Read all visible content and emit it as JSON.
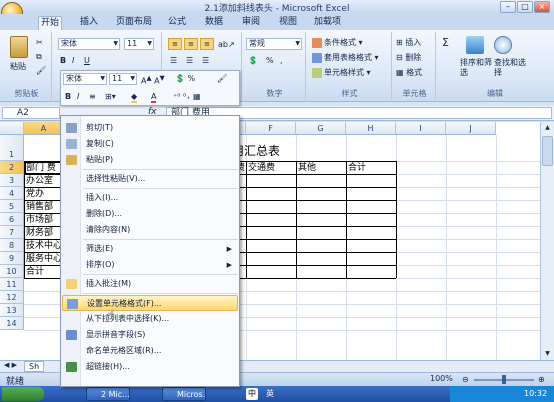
{
  "window": {
    "title": "2.1添加斜线表头 - Microsoft Excel"
  },
  "tabs": [
    "开始",
    "插入",
    "页面布局",
    "公式",
    "数据",
    "审阅",
    "视图",
    "加载项"
  ],
  "ribbon": {
    "paste": "粘贴",
    "clipboard_label": "剪贴板",
    "font_name": "宋体",
    "font_size": "11",
    "number_format": "常规",
    "number_label": "数字",
    "styles": {
      "conditional": "条件格式",
      "table": "套用表格格式",
      "cell": "单元格样式",
      "label": "样式"
    },
    "cells": {
      "insert": "插入",
      "delete": "删除",
      "format": "格式",
      "label": "单元格"
    },
    "editing": {
      "sort": "排序和筛选",
      "find": "查找和选择",
      "label": "编辑"
    }
  },
  "mini_toolbar": {
    "font_name": "宋体",
    "font_size": "11"
  },
  "formula_bar": {
    "name_box": "A2",
    "fx": "fx",
    "value": "部门 费用"
  },
  "sheet": {
    "columns": [
      "A",
      "B",
      "C",
      "D",
      "E",
      "F",
      "G",
      "H",
      "I",
      "J"
    ],
    "rows": [
      "1",
      "2",
      "3",
      "4",
      "5",
      "6",
      "7",
      "8",
      "9",
      "10",
      "11",
      "12",
      "13",
      "14"
    ],
    "title_text": "用汇总表",
    "header_cells": [
      "部门 费",
      "费",
      "交通费",
      "其他",
      "合计"
    ],
    "col_a": [
      "办公室",
      "党办",
      "销售部",
      "市场部",
      "财务部",
      "技术中心",
      "服务中心",
      "合计"
    ]
  },
  "context_menu": [
    {
      "label": "剪切(T)",
      "icon": "scissors-icon"
    },
    {
      "label": "复制(C)",
      "icon": "copy-icon"
    },
    {
      "label": "粘贴(P)",
      "icon": "paste-icon"
    },
    {
      "label": "选择性粘贴(V)...",
      "icon": ""
    },
    {
      "label": "插入(I)...",
      "icon": ""
    },
    {
      "label": "删除(D)...",
      "icon": ""
    },
    {
      "label": "清除内容(N)",
      "icon": ""
    },
    {
      "label": "筛选(E)",
      "icon": "",
      "sub": true
    },
    {
      "label": "排序(O)",
      "icon": "",
      "sub": true
    },
    {
      "label": "插入批注(M)",
      "icon": "comment-icon"
    },
    {
      "label": "设置单元格格式(F)...",
      "icon": "format-cells-icon",
      "highlighted": true
    },
    {
      "label": "从下拉列表中选择(K)...",
      "icon": ""
    },
    {
      "label": "显示拼音字段(S)",
      "icon": "phonetic-icon"
    },
    {
      "label": "命名单元格区域(R)...",
      "icon": ""
    },
    {
      "label": "超链接(H)...",
      "icon": "hyperlink-icon"
    }
  ],
  "status": {
    "ready": "就绪",
    "zoom": "100%"
  },
  "sheet_tab": "Sh",
  "taskbar": {
    "items": [
      "2 Mic...",
      "Micros..."
    ],
    "lang": "中",
    "tray_text": "英",
    "time": "10:32"
  },
  "colors": {
    "highlight": "#ffd773",
    "ribbon": "#dbe7f6",
    "taskbar": "#1f4fa3"
  }
}
